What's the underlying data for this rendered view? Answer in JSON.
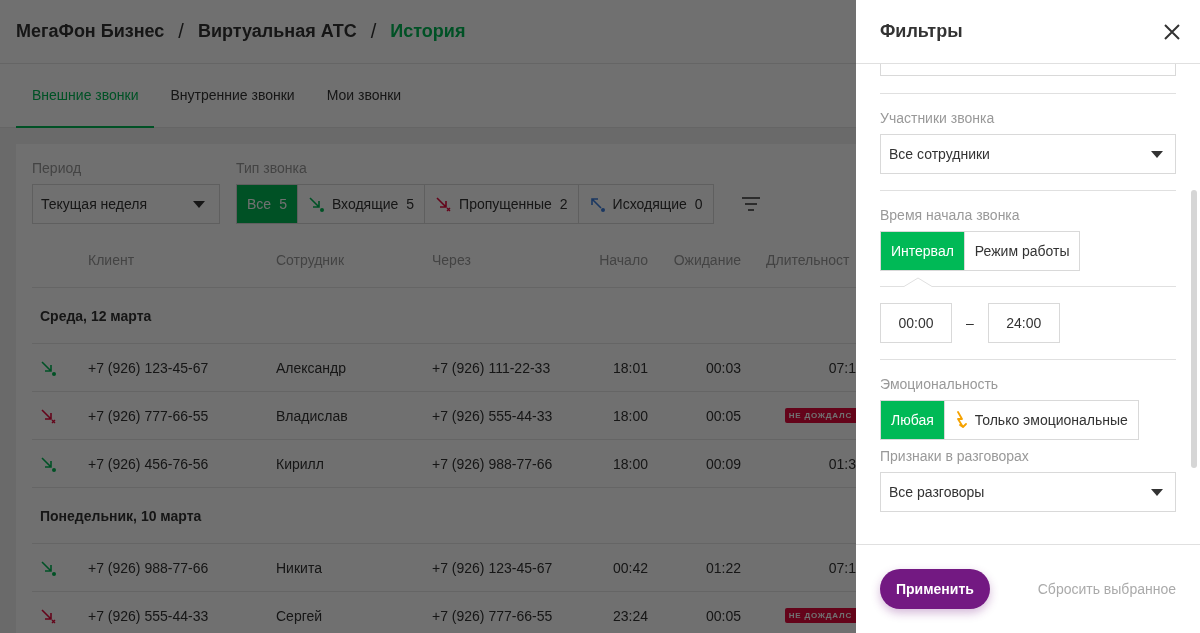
{
  "breadcrumb": [
    {
      "label": "МегаФон Бизнес",
      "current": false
    },
    {
      "label": "Виртуальная АТС",
      "current": false
    },
    {
      "label": "История",
      "current": true
    }
  ],
  "separator": "/",
  "tabs": [
    {
      "label": "Внешние звонки",
      "selected": true
    },
    {
      "label": "Внутренние звонки",
      "selected": false
    },
    {
      "label": "Мои звонки",
      "selected": false
    }
  ],
  "filters": {
    "period": {
      "label": "Период",
      "value": "Текущая неделя"
    },
    "call_type": {
      "label": "Тип звонка",
      "options": [
        {
          "kind": "all",
          "label": "Все",
          "count": "5",
          "selected": true
        },
        {
          "kind": "incoming",
          "label": "Входящие",
          "count": "5",
          "selected": false
        },
        {
          "kind": "missed",
          "label": "Пропущенные",
          "count": "2",
          "selected": false
        },
        {
          "kind": "outgoing",
          "label": "Исходящие",
          "count": "0",
          "selected": false
        }
      ]
    }
  },
  "table": {
    "columns": [
      "Клиент",
      "Сотрудник",
      "Через",
      "Начало",
      "Ожидание",
      "Длительност"
    ],
    "groups": [
      {
        "title": "Среда, 12 марта",
        "rows": [
          {
            "kind": "incoming",
            "client": "+7 (926) 123-45-67",
            "employee": "Александр",
            "via": "+7 (926) 111-22-33",
            "start": "18:01",
            "wait": "00:03",
            "duration": "07:1"
          },
          {
            "kind": "missed",
            "client": "+7 (926) 777-66-55",
            "employee": "Владислав",
            "via": "+7 (926) 555-44-33",
            "start": "18:00",
            "wait": "00:05",
            "status": "НЕ ДОЖДАЛС"
          },
          {
            "kind": "incoming",
            "client": "+7 (926) 456-76-56",
            "employee": "Кирилл",
            "via": "+7 (926) 988-77-66",
            "start": "18:00",
            "wait": "00:09",
            "duration": "01:3"
          }
        ]
      },
      {
        "title": "Понедельник, 10 марта",
        "rows": [
          {
            "kind": "incoming",
            "client": "+7 (926) 988-77-66",
            "employee": "Никита",
            "via": "+7 (926) 123-45-67",
            "start": "00:42",
            "wait": "01:22",
            "duration": "07:1"
          },
          {
            "kind": "missed",
            "client": "+7 (926) 555-44-33",
            "employee": "Сергей",
            "via": "+7 (926) 777-66-55",
            "start": "23:24",
            "wait": "00:05",
            "status": "НЕ ДОЖДАЛС"
          }
        ]
      }
    ]
  },
  "drawer": {
    "title": "Фильтры",
    "participants": {
      "label": "Участники звонка",
      "value": "Все сотрудники"
    },
    "start_time": {
      "label": "Время начала звонка",
      "modes": [
        {
          "label": "Интервал",
          "selected": true
        },
        {
          "label": "Режим работы",
          "selected": false
        }
      ],
      "from": "00:00",
      "to": "24:00",
      "dash": "–"
    },
    "emotion": {
      "label": "Эмоциональность",
      "options": [
        {
          "kind": "any",
          "label": "Любая",
          "selected": true
        },
        {
          "kind": "emotional",
          "label": "Только эмоциональные",
          "selected": false
        }
      ]
    },
    "signs": {
      "label": "Признаки в разговорах",
      "value": "Все разговоры"
    },
    "apply": "Применить",
    "reset": "Сбросить выбранное"
  }
}
